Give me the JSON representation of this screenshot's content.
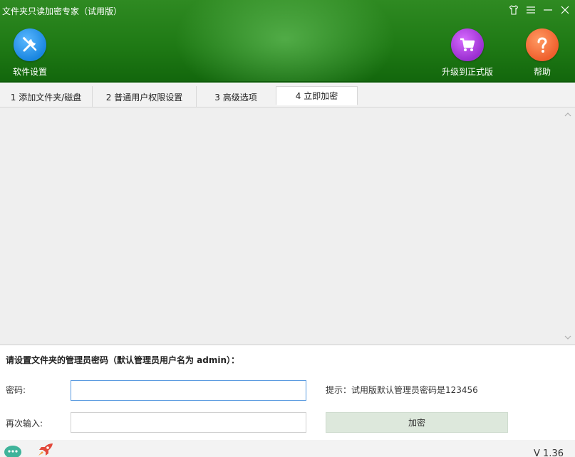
{
  "window": {
    "title": "文件夹只读加密专家（试用版）"
  },
  "toolbar": {
    "settings_label": "软件设置",
    "upgrade_label": "升级到正式版",
    "help_label": "帮助"
  },
  "tabs": [
    {
      "label": "1 添加文件夹/磁盘"
    },
    {
      "label": "2 普通用户权限设置"
    },
    {
      "label": "3 高级选项"
    },
    {
      "label": "4 立即加密"
    }
  ],
  "form": {
    "title": "请设置文件夹的管理员密码（默认管理员用户名为 admin）：",
    "password_label": "密码:",
    "password_value": "",
    "confirm_label": "再次输入:",
    "confirm_value": "",
    "hint": "提示：试用版默认管理员密码是123456",
    "encrypt_button": "加密"
  },
  "status": {
    "version": "V 1.36"
  },
  "icons": {
    "skin": "shirt-icon",
    "menu": "menu-icon",
    "minimize": "minimize-icon",
    "close": "close-icon",
    "settings": "tools-icon",
    "upgrade": "cart-icon",
    "help": "question-icon",
    "chat": "chat-icon",
    "rocket": "rocket-icon"
  },
  "colors": {
    "header_green": "#1f7a15",
    "settings_blue": "#1a86e0",
    "upgrade_purple": "#9a2fd0",
    "help_orange": "#ef5f2d",
    "button_bg": "#dde8dc"
  }
}
